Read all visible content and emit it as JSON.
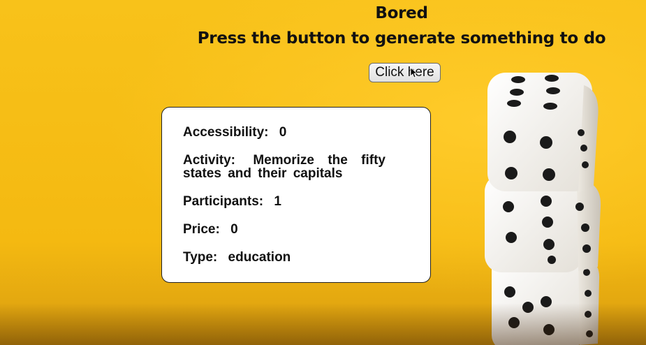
{
  "page": {
    "title": "Bored",
    "subtitle": "Press the button to generate something to do",
    "button_label": "Click here"
  },
  "activity": {
    "accessibility_label": "Accessibility:",
    "accessibility_value": "0",
    "activity_label": "Activity:",
    "activity_value": "Memorize the fifty states and their capitals",
    "participants_label": "Participants:",
    "participants_value": "1",
    "price_label": "Price:",
    "price_value": "0",
    "type_label": "Type:",
    "type_value": "education"
  },
  "decor": {
    "background_color": "#f6bd17",
    "image": "dice-stack-image",
    "cursor": "mouse-pointer-icon"
  }
}
